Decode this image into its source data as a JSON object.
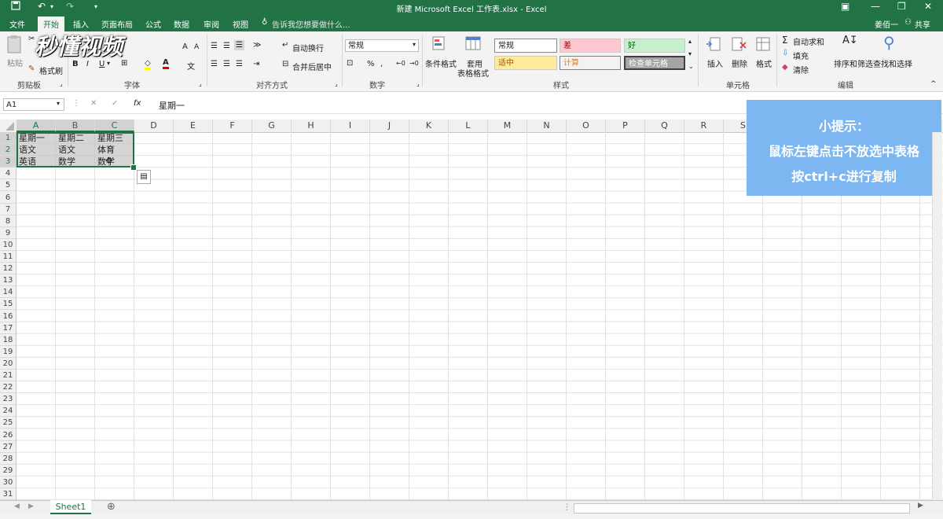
{
  "window": {
    "title": "新建 Microsoft Excel 工作表.xlsx - Excel",
    "user": "姜佰一",
    "share": "共享"
  },
  "tabs": [
    "文件",
    "开始",
    "插入",
    "页面布局",
    "公式",
    "数据",
    "审阅",
    "视图"
  ],
  "tell_me": "告诉我您想要做什么...",
  "ribbon": {
    "clipboard": {
      "label": "剪贴板",
      "paste": "粘贴",
      "format_painter": "格式刷"
    },
    "font": {
      "label": "字体",
      "bold": "B",
      "italic": "I",
      "underline": "U",
      "font_color": "A",
      "grow": "A",
      "shrink": "A",
      "wen": "文"
    },
    "alignment": {
      "label": "对齐方式",
      "wrap": "自动换行",
      "merge": "合并后居中"
    },
    "number": {
      "label": "数字",
      "format": "常规",
      "percent": "%",
      "comma": ","
    },
    "styles": {
      "label": "样式",
      "cond_format": "条件格式",
      "table_format_1": "套用",
      "table_format_2": "表格格式",
      "items": [
        "常规",
        "差",
        "好",
        "适中",
        "计算",
        "检查单元格"
      ]
    },
    "cells": {
      "label": "单元格",
      "insert": "插入",
      "delete": "删除",
      "format": "格式"
    },
    "editing": {
      "label": "编辑",
      "autosum": "自动求和",
      "fill": "填充",
      "clear": "清除",
      "sort": "排序和筛选",
      "find": "查找和选择"
    }
  },
  "watermark": "秒懂视频",
  "formula_bar": {
    "name_box": "A1",
    "fx": "fx",
    "content": "星期一"
  },
  "columns": [
    "A",
    "B",
    "C",
    "D",
    "E",
    "F",
    "G",
    "H",
    "I",
    "J",
    "K",
    "L",
    "M",
    "N",
    "O",
    "P",
    "Q",
    "R",
    "S"
  ],
  "rows": [
    "1",
    "2",
    "3",
    "4",
    "5",
    "6",
    "7",
    "8",
    "9",
    "10",
    "11",
    "12",
    "13",
    "14",
    "15",
    "16",
    "17",
    "18",
    "19",
    "20",
    "21",
    "22",
    "23",
    "24",
    "25",
    "26",
    "27",
    "28",
    "29",
    "30",
    "31"
  ],
  "grid": [
    [
      "星期一",
      "星期二",
      "星期三"
    ],
    [
      "语文",
      "语文",
      "体育"
    ],
    [
      "英语",
      "数学",
      "数学"
    ]
  ],
  "tip": {
    "title": "小提示：",
    "line1": "鼠标左键点击不放选中表格",
    "line2": "按ctrl+c进行复制"
  },
  "sheet_tab": "Sheet1",
  "colors": {
    "excel_green": "#217346",
    "tip_blue": "#7cb7f2",
    "bad_fill": "#ffc7ce",
    "good_fill": "#c6efce",
    "neutral_fill": "#ffeb9c"
  }
}
